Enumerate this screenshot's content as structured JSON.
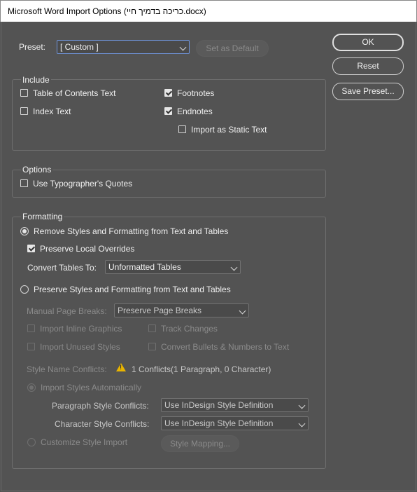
{
  "window": {
    "title": "Microsoft Word Import Options (כריכה בדמיך חיי.docx)"
  },
  "preset": {
    "label": "Preset:",
    "value": "[ Custom ]",
    "set_default_label": "Set as Default"
  },
  "buttons": {
    "ok": "OK",
    "reset": "Reset",
    "save_preset": "Save Preset..."
  },
  "include": {
    "title": "Include",
    "toc": {
      "label": "Table of Contents Text",
      "checked": false
    },
    "index": {
      "label": "Index Text",
      "checked": false
    },
    "footnotes": {
      "label": "Footnotes",
      "checked": true
    },
    "endnotes": {
      "label": "Endnotes",
      "checked": true
    },
    "static_text": {
      "label": "Import as Static Text",
      "checked": false
    }
  },
  "options": {
    "title": "Options",
    "typographers_quotes": {
      "label": "Use Typographer's Quotes",
      "checked": false
    }
  },
  "formatting": {
    "title": "Formatting",
    "remove_styles": {
      "label": "Remove Styles and Formatting from Text and Tables",
      "selected": true
    },
    "preserve_local": {
      "label": "Preserve Local Overrides",
      "checked": true
    },
    "convert_tables": {
      "label": "Convert Tables To:",
      "value": "Unformatted Tables"
    },
    "preserve_styles": {
      "label": "Preserve Styles and Formatting from Text and Tables",
      "selected": false
    },
    "manual_breaks": {
      "label": "Manual Page Breaks:",
      "value": "Preserve Page Breaks"
    },
    "inline_graphics": {
      "label": "Import Inline Graphics"
    },
    "track_changes": {
      "label": "Track Changes"
    },
    "unused_styles": {
      "label": "Import Unused Styles"
    },
    "convert_bullets": {
      "label": "Convert Bullets & Numbers to Text"
    },
    "conflicts": {
      "label": "Style Name Conflicts:",
      "value": "1 Conflicts(1 Paragraph, 0 Character)"
    },
    "import_auto": {
      "label": "Import Styles Automatically"
    },
    "para_conflicts": {
      "label": "Paragraph Style Conflicts:",
      "value": "Use InDesign Style Definition"
    },
    "char_conflicts": {
      "label": "Character Style Conflicts:",
      "value": "Use InDesign Style Definition"
    },
    "customize": {
      "label": "Customize Style Import"
    },
    "style_mapping": "Style Mapping..."
  },
  "colors": {
    "background": "#535353",
    "warning": "#e8b400",
    "focus": "#6f93d8"
  }
}
